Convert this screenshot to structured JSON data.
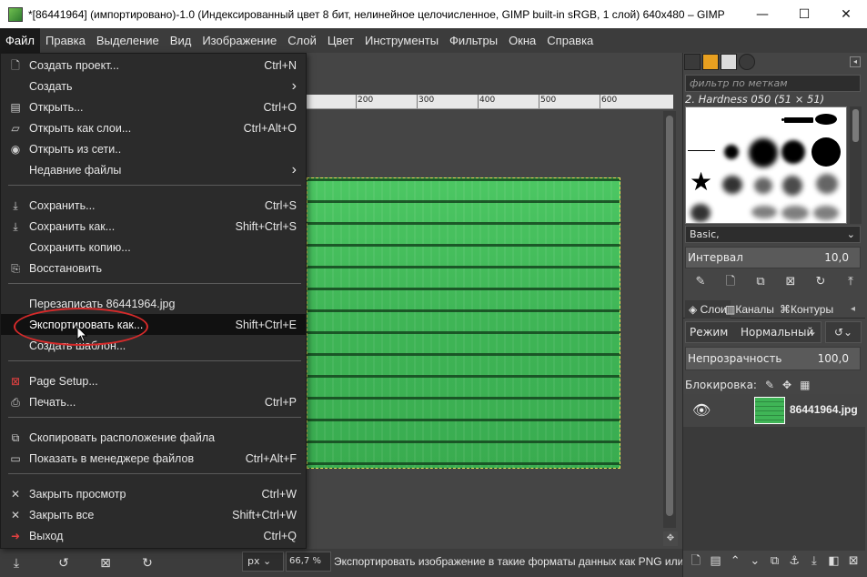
{
  "window": {
    "title": "*[86441964] (импортировано)-1.0 (Индексированный цвет 8 бит, нелинейное целочисленное, GIMP built-in sRGB, 1 слой) 640x480 – GIMP",
    "minimize": "—",
    "maximize": "☐",
    "close": "✕"
  },
  "menubar": [
    {
      "label": "Файл"
    },
    {
      "label": "Правка"
    },
    {
      "label": "Выделение"
    },
    {
      "label": "Вид"
    },
    {
      "label": "Изображение"
    },
    {
      "label": "Слой"
    },
    {
      "label": "Цвет"
    },
    {
      "label": "Инструменты"
    },
    {
      "label": "Фильтры"
    },
    {
      "label": "Окна"
    },
    {
      "label": "Справка"
    }
  ],
  "file_menu": {
    "items": [
      {
        "label": "Создать проект...",
        "accel": "Ctrl+N",
        "icon": "new-file-icon"
      },
      {
        "label": "Создать",
        "accel": "›",
        "icon": ""
      },
      {
        "label": "Открыть...",
        "accel": "Ctrl+O",
        "icon": "open-icon"
      },
      {
        "label": "Открыть как слои...",
        "accel": "Ctrl+Alt+O",
        "icon": "open-layers-icon"
      },
      {
        "label": "Открыть из сети..",
        "accel": "",
        "icon": "web-icon"
      },
      {
        "label": "Недавние файлы",
        "accel": "›",
        "icon": ""
      },
      {
        "label": "Сохранить...",
        "accel": "Ctrl+S",
        "icon": "save-icon"
      },
      {
        "label": "Сохранить как...",
        "accel": "Shift+Ctrl+S",
        "icon": "save-as-icon"
      },
      {
        "label": "Сохранить копию...",
        "accel": "",
        "icon": ""
      },
      {
        "label": "Восстановить",
        "accel": "",
        "icon": "revert-icon"
      },
      {
        "label": "Перезаписать 86441964.jpg",
        "accel": "",
        "icon": ""
      },
      {
        "label": "Экспортировать как...",
        "accel": "Shift+Ctrl+E",
        "icon": ""
      },
      {
        "label": "Создать шаблон...",
        "accel": "",
        "icon": ""
      },
      {
        "label": "Page Setup...",
        "accel": "",
        "icon": "page-setup-icon"
      },
      {
        "label": "Печать...",
        "accel": "Ctrl+P",
        "icon": "print-icon"
      },
      {
        "label": "Скопировать расположение файла",
        "accel": "",
        "icon": "copy-location-icon"
      },
      {
        "label": "Показать в менеджере файлов",
        "accel": "Ctrl+Alt+F",
        "icon": "file-manager-icon"
      },
      {
        "label": "Закрыть просмотр",
        "accel": "Ctrl+W",
        "icon": "close-view-icon"
      },
      {
        "label": "Закрыть все",
        "accel": "Shift+Ctrl+W",
        "icon": "close-all-icon"
      },
      {
        "label": "Выход",
        "accel": "Ctrl+Q",
        "icon": "quit-icon"
      }
    ]
  },
  "ruler": {
    "labels": [
      "200",
      "300",
      "400",
      "500",
      "600"
    ]
  },
  "statusbar": {
    "unit": "px",
    "zoom": "66,7 %",
    "message": "Экспортировать изображение в такие форматы данных как PNG или JPEG"
  },
  "brushes": {
    "filter_placeholder": "фильтр по меткам",
    "selected_name": "2. Hardness 050 (51 × 51)",
    "preset": "Basic,",
    "spacing_label": "Интервал",
    "spacing_value": "10,0"
  },
  "layers": {
    "tabs": [
      "Слои",
      "Каналы",
      "Контуры"
    ],
    "mode_label": "Режим",
    "mode_value": "Нормальный",
    "opacity_label": "Непрозрачность",
    "opacity_value": "100,0",
    "lock_label": "Блокировка:",
    "layer_name": "86441964.jpg"
  },
  "colors": {
    "accent_highlight": "#111111",
    "ellipse": "#d62a2a",
    "image_green": "#3fb556"
  }
}
